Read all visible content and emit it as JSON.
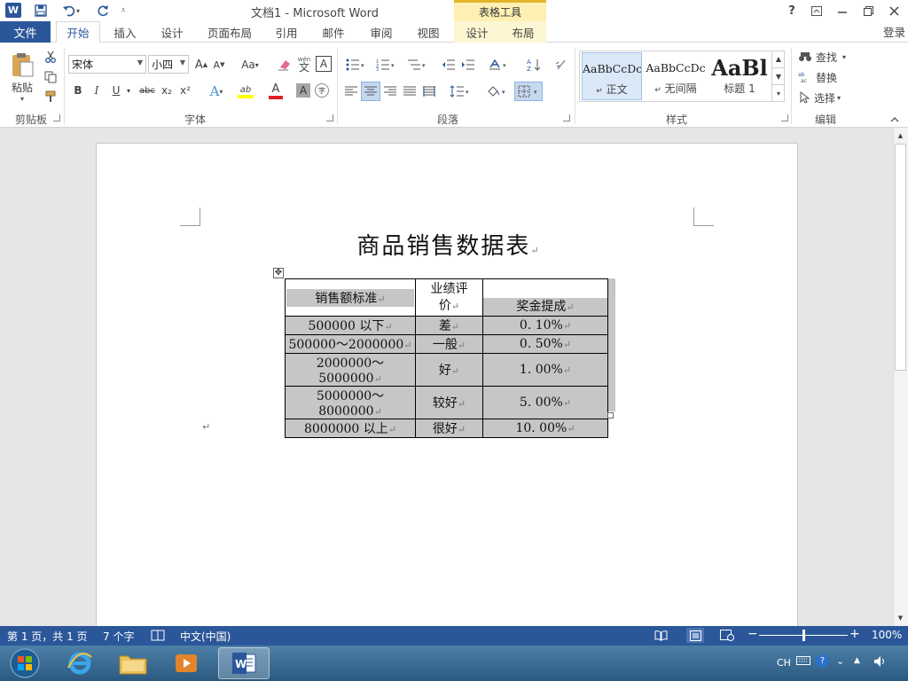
{
  "titlebar": {
    "app_icon": "W",
    "title": "文档1 - Microsoft Word",
    "context_tools": "表格工具",
    "quick_access": {
      "save": "save-icon",
      "undo": "undo-icon",
      "repeat": "repeat-icon",
      "customize": "customize-icon"
    },
    "help": "?",
    "login": "登录"
  },
  "tabs": {
    "file": "文件",
    "home": "开始",
    "insert": "插入",
    "design": "设计",
    "page_layout": "页面布局",
    "references": "引用",
    "mailings": "邮件",
    "review": "审阅",
    "view": "视图",
    "table_design": "设计",
    "table_layout": "布局"
  },
  "ribbon": {
    "clipboard": {
      "label": "剪贴板",
      "paste": "粘贴"
    },
    "font": {
      "label": "字体",
      "font_name": "宋体",
      "font_size": "小四",
      "bold": "B",
      "italic": "I",
      "underline": "U",
      "strike": "abc",
      "sub": "x₂",
      "sup": "x²",
      "grow": "A",
      "shrink": "A",
      "case": "Aa",
      "phonetic_top": "wén",
      "phonetic": "文",
      "border_char": "A",
      "shading_char": "A",
      "enclose_char": "字",
      "effects": "A",
      "highlight": "ab",
      "color": "A"
    },
    "paragraph": {
      "label": "段落"
    },
    "styles": {
      "label": "样式",
      "items": [
        {
          "preview": "AaBbCcDc",
          "name": "正文"
        },
        {
          "preview": "AaBbCcDc",
          "name": "无间隔"
        },
        {
          "preview": "AaBl",
          "name": "标题 1"
        }
      ]
    },
    "editing": {
      "label": "编辑",
      "find": "查找",
      "replace": "替换",
      "select": "选择"
    }
  },
  "document": {
    "heading": "商品销售数据表",
    "table": {
      "headers": [
        "销售额标准",
        "业绩评价",
        "奖金提成"
      ],
      "rows": [
        [
          "500000 以下",
          "差",
          "0. 10%"
        ],
        [
          "500000～2000000",
          "一般",
          "0. 50%"
        ],
        [
          "2000000～5000000",
          "好",
          "1. 00%"
        ],
        [
          "5000000～8000000",
          "较好",
          "5. 00%"
        ],
        [
          "8000000 以上",
          "很好",
          "10. 00%"
        ]
      ]
    }
  },
  "statusbar": {
    "page": "第 1 页，共 1 页",
    "words": "7 个字",
    "language": "中文(中国)",
    "zoom": "100%",
    "zoom_level": 1.0
  },
  "taskbar": {
    "ime": "CH"
  },
  "colors": {
    "accent": "#2b579a",
    "context": "#fdf0b2",
    "cell_shading": "#c6c6c6"
  }
}
